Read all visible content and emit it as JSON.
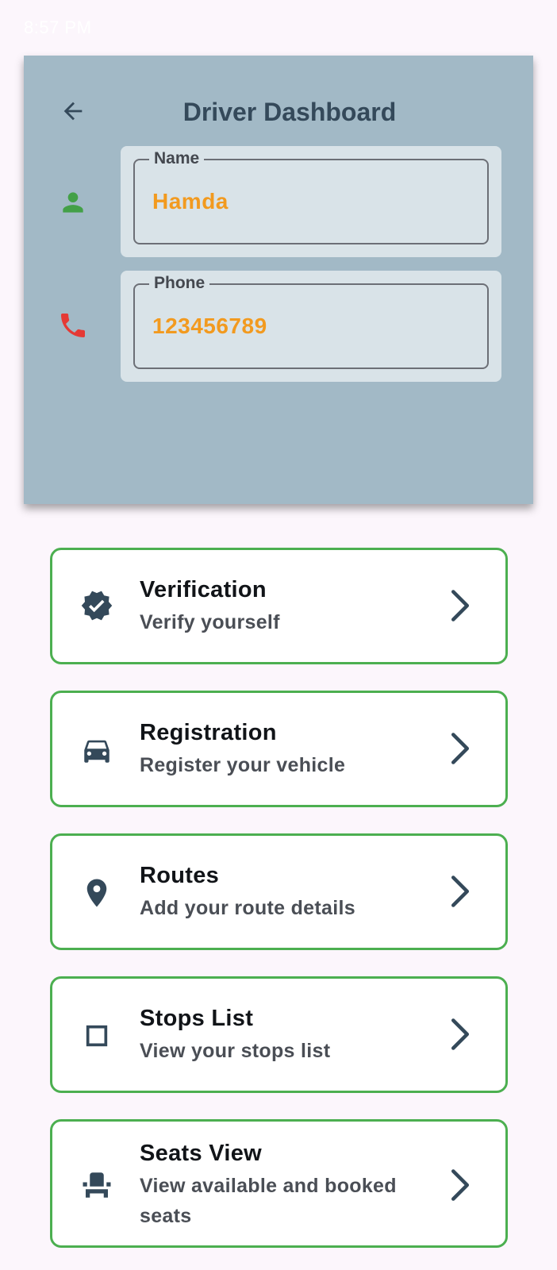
{
  "status_bar": {
    "time": "8:57 PM",
    "icons_text": ""
  },
  "header": {
    "title": "Driver Dashboard",
    "fields": [
      {
        "label": "Name",
        "value": "Hamda",
        "icon": "person-icon",
        "icon_color": "#43a047"
      },
      {
        "label": "Phone",
        "value": "123456789",
        "icon": "phone-icon",
        "icon_color": "#e53935"
      }
    ]
  },
  "menu": [
    {
      "title": "Verification",
      "subtitle": "Verify yourself",
      "icon": "verified-badge-icon"
    },
    {
      "title": "Registration",
      "subtitle": "Register your vehicle",
      "icon": "car-icon"
    },
    {
      "title": "Routes",
      "subtitle": "Add your route details",
      "icon": "location-pin-icon"
    },
    {
      "title": "Stops List",
      "subtitle": "View your stops list",
      "icon": "square-icon"
    },
    {
      "title": "Seats View",
      "subtitle": "View available and booked seats",
      "icon": "seat-icon"
    }
  ],
  "colors": {
    "header_bg": "#a2b9c6",
    "field_bg": "#d9e3e8",
    "value_text": "#f29a1f",
    "card_border": "#4caf50",
    "icon_dark": "#34495a"
  }
}
